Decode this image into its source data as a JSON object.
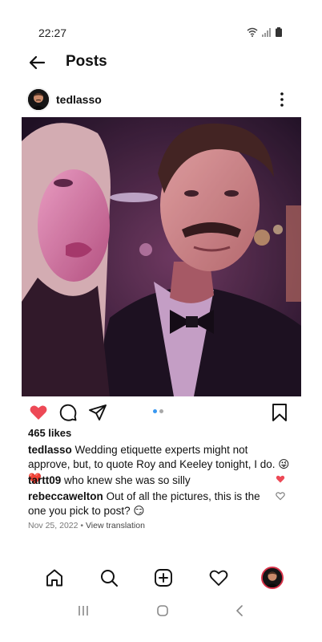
{
  "status": {
    "time": "22:27"
  },
  "header": {
    "title": "Posts"
  },
  "post": {
    "username": "tedlasso",
    "likes": "465 likes",
    "caption": {
      "username": "tedlasso",
      "text": "Wedding etiquette experts might not approve, but, to quote Roy and Keeley tonight, I do. 😜❤️"
    },
    "comments": [
      {
        "username": "tartt09",
        "text": "who knew she was so silly",
        "liked": true
      },
      {
        "username": "rebeccawelton",
        "text": "Out of all the pictures, this is the one you pick to post? 😏",
        "liked": false
      }
    ],
    "date": "Nov 25, 2022",
    "separator": " • ",
    "translate": "View translation",
    "liked": true,
    "carousel": {
      "count": 2,
      "active": 2
    }
  },
  "colors": {
    "like": "#ed4956",
    "text": "#111111",
    "muted": "#777777",
    "dot_active": "#3897f0",
    "dot_inactive": "#a8a8a8"
  },
  "icons": {
    "status": [
      "wifi-icon",
      "signal-icon",
      "battery-icon"
    ],
    "actions": [
      "heart-icon",
      "comment-icon",
      "share-icon",
      "bookmark-icon"
    ],
    "nav": [
      "home-icon",
      "search-icon",
      "create-icon",
      "activity-heart-icon",
      "profile-avatar"
    ],
    "system": [
      "recents-icon",
      "home-circle-icon",
      "back-chevron-icon"
    ]
  }
}
